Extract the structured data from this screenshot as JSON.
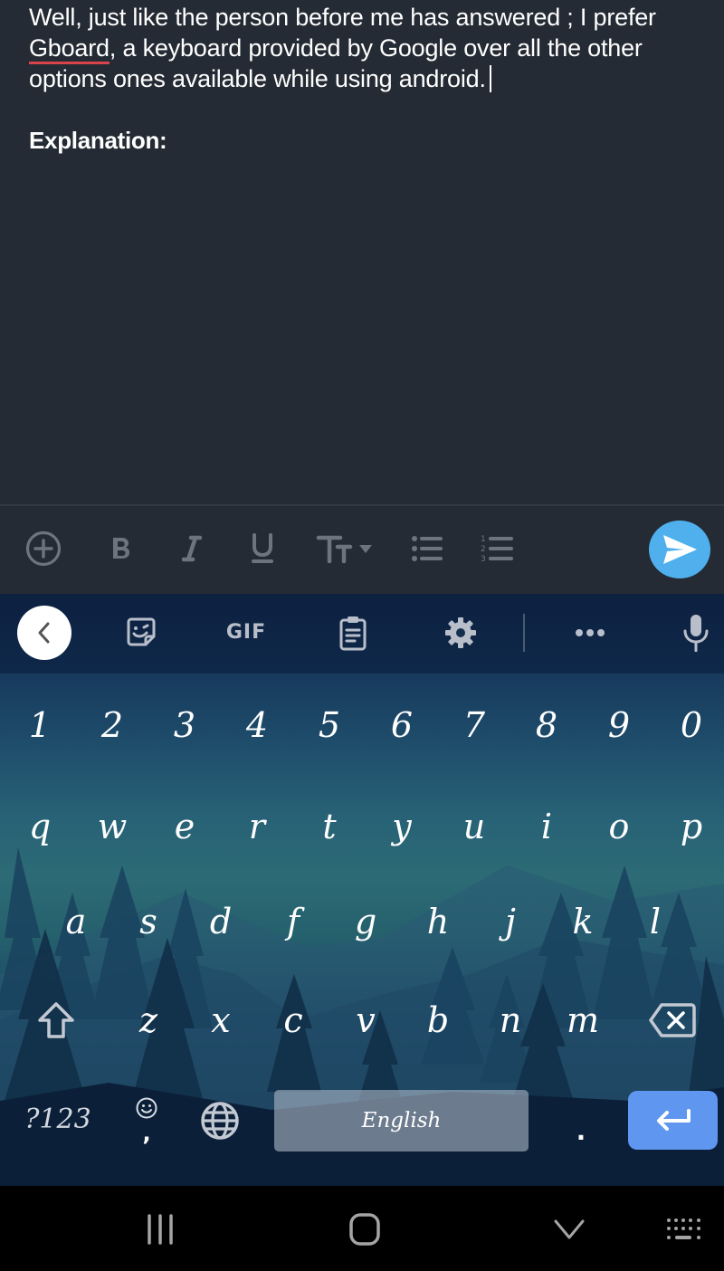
{
  "editor": {
    "paragraph_parts": {
      "before": "Well, just like the person before me has answered ; I prefer ",
      "misspelled_word": "Gboard",
      "after": ", a keyboard provided by Google over all the other options ones available while using android."
    },
    "heading": "Explanation:"
  },
  "format_toolbar": {
    "items": [
      {
        "name": "add",
        "icon": "plus-circle-icon"
      },
      {
        "name": "bold",
        "label": "B"
      },
      {
        "name": "italic",
        "label": "I"
      },
      {
        "name": "underline",
        "label": "U"
      },
      {
        "name": "text-size",
        "label": "TT",
        "icon": "caret-down-icon"
      },
      {
        "name": "bullet-list",
        "icon": "bullet-list-icon"
      },
      {
        "name": "numbered-list",
        "icon": "numbered-list-icon"
      }
    ],
    "send": {
      "icon": "send-icon",
      "color": "#4fb0ed"
    }
  },
  "keyboard": {
    "toolbar": {
      "back": "chevron-left-icon",
      "sticker": "sticker-icon",
      "gif_label": "GIF",
      "clipboard": "clipboard-icon",
      "settings": "gear-icon",
      "more": "more-dots-icon",
      "voice": "microphone-icon"
    },
    "rows": [
      [
        "1",
        "2",
        "3",
        "4",
        "5",
        "6",
        "7",
        "8",
        "9",
        "0"
      ],
      [
        "q",
        "w",
        "e",
        "r",
        "t",
        "y",
        "u",
        "i",
        "o",
        "p"
      ],
      [
        "a",
        "s",
        "d",
        "f",
        "g",
        "h",
        "j",
        "k",
        "l"
      ],
      [
        "z",
        "x",
        "c",
        "v",
        "b",
        "n",
        "m"
      ]
    ],
    "bottom_row": {
      "symbols_label": "?123",
      "comma_key": ",",
      "comma_hint": "emoji-icon",
      "language": "globe-icon",
      "space_label": "English",
      "period_key": ".",
      "enter": "enter-icon"
    },
    "enter_color": "#5f96f0"
  },
  "navbar": {
    "recents": "recents-icon",
    "home": "home-icon",
    "back": "hide-keyboard-icon",
    "keyboard": "keyboard-switch-icon"
  }
}
